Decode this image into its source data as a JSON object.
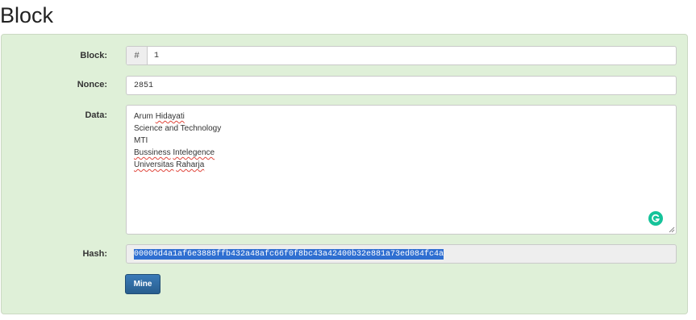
{
  "page": {
    "title": "Block"
  },
  "form": {
    "block": {
      "label": "Block:",
      "prefix": "#",
      "value": "1"
    },
    "nonce": {
      "label": "Nonce:",
      "value": "2851"
    },
    "data": {
      "label": "Data:",
      "lines": [
        "Arum Hidayati",
        "Science and Technology",
        "MTI",
        "Bussiness Intelegence",
        "Universitas Raharja"
      ]
    },
    "hash": {
      "label": "Hash:",
      "value": "00006d4a1af6e3888ffb432a48afc66f0f8bc43a42400b32e881a73ed084fc4a"
    },
    "mine_button": "Mine"
  },
  "icons": {
    "grammar": "grammarly-icon",
    "resize": "resize-handle-icon"
  },
  "colors": {
    "panel_bg": "#dff0d8",
    "button": "#337ab7",
    "selection": "#2f6fd1",
    "grammarly": "#15c39a"
  }
}
